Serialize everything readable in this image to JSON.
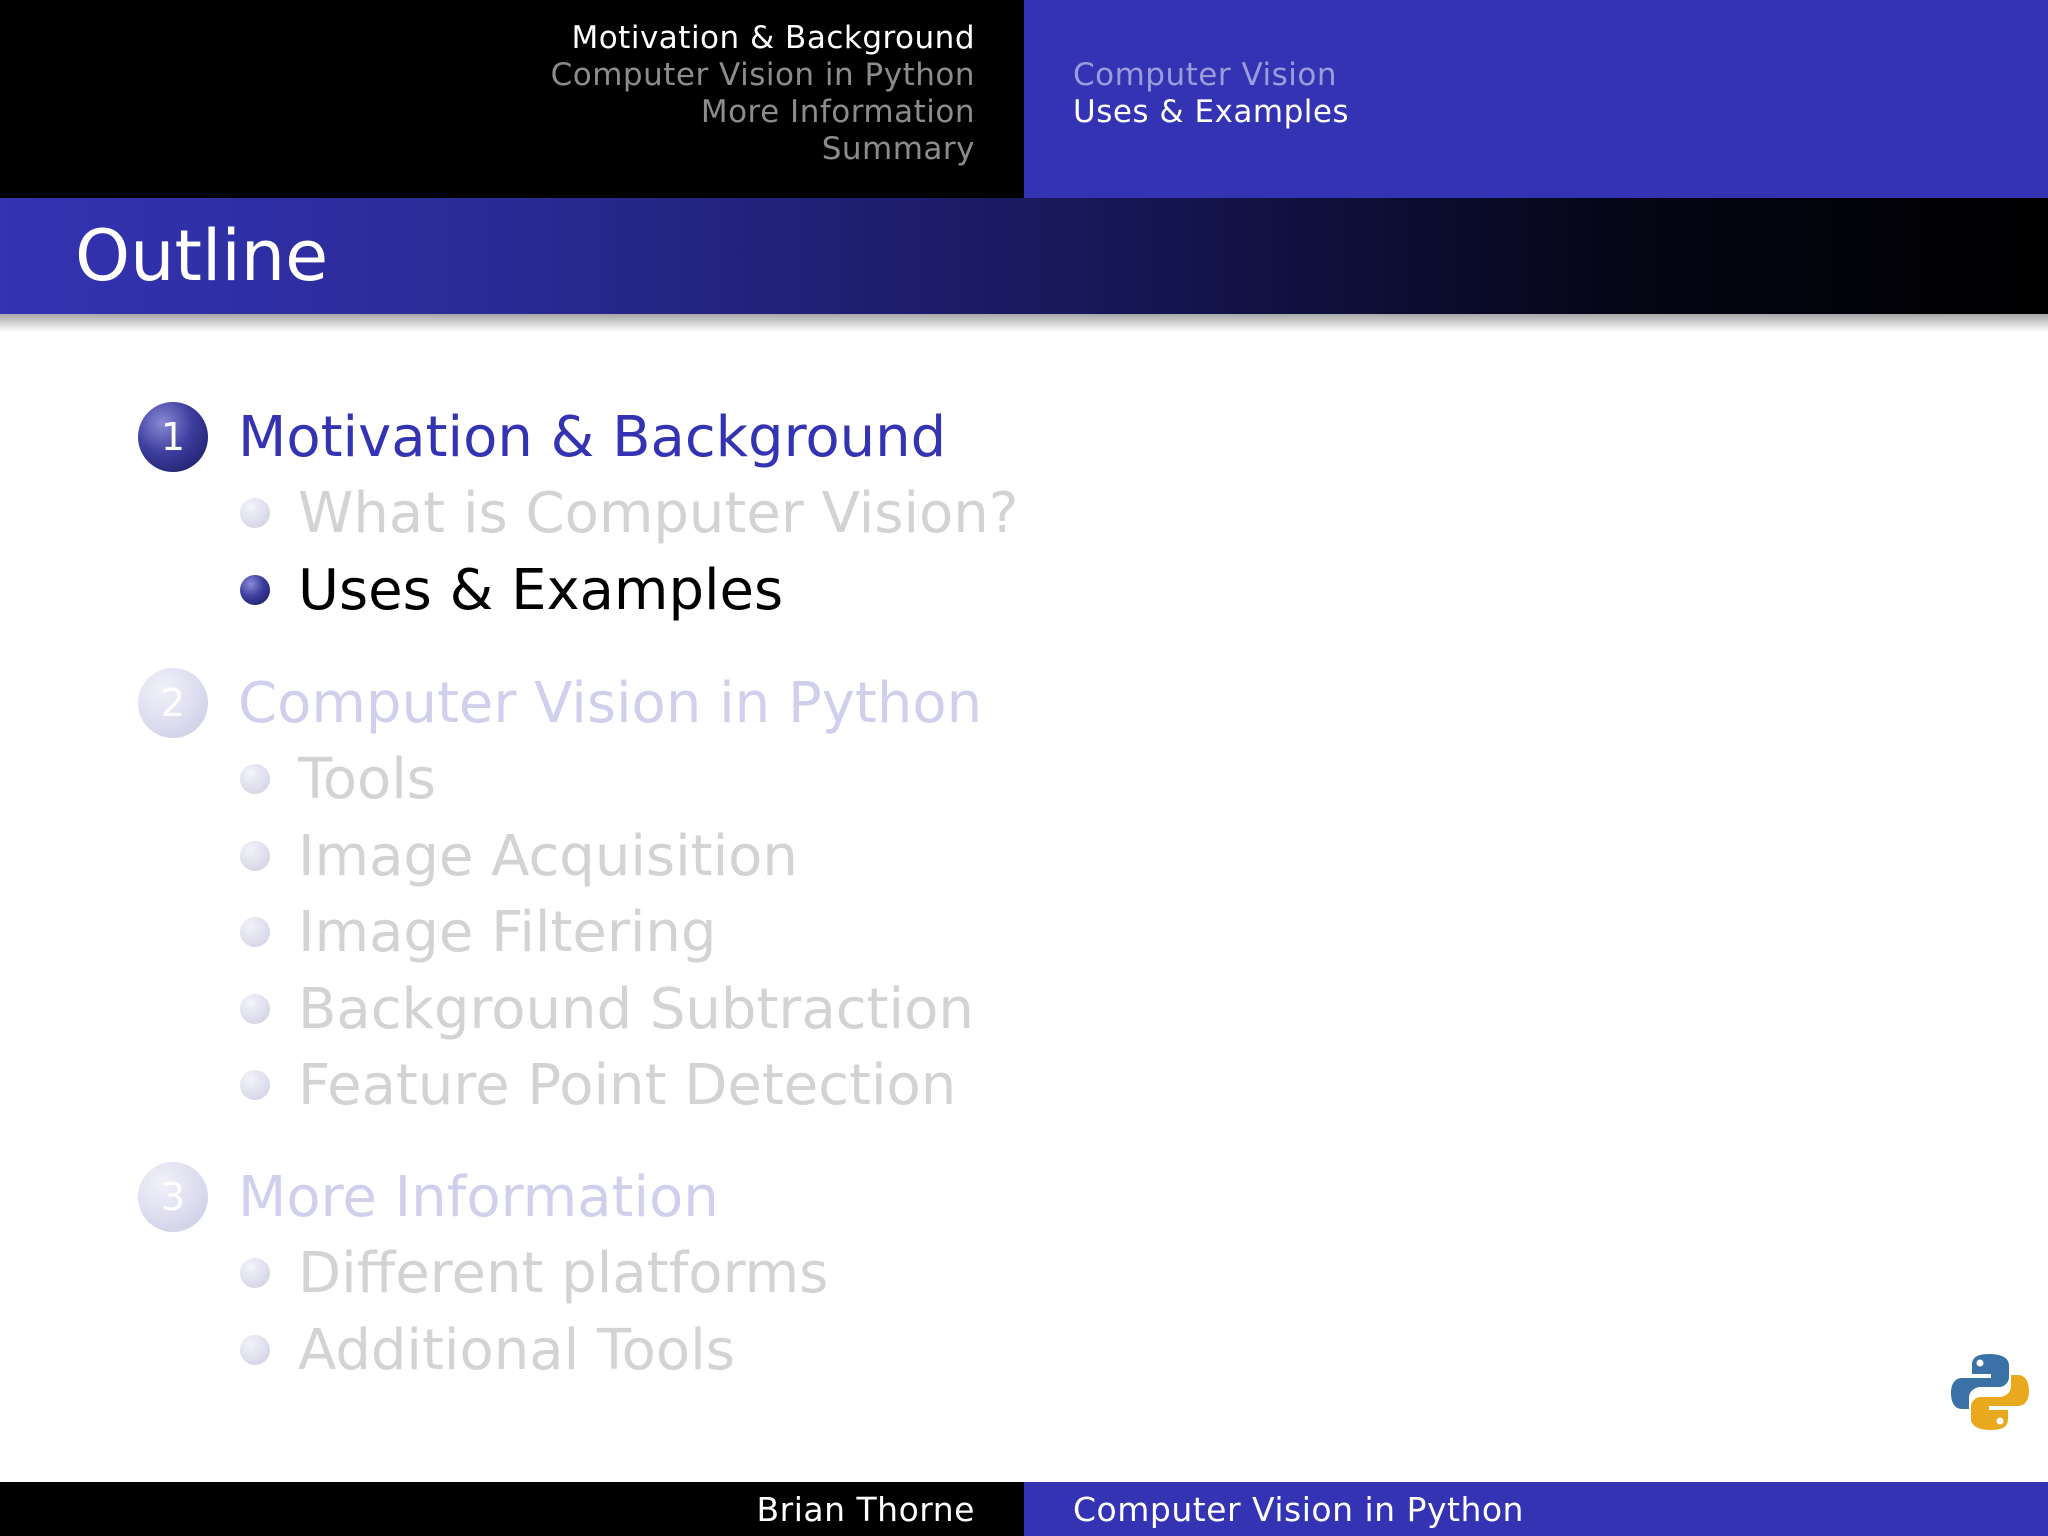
{
  "header": {
    "sections": [
      {
        "label": "Motivation & Background",
        "active": true
      },
      {
        "label": "Computer Vision in Python",
        "active": false
      },
      {
        "label": "More Information",
        "active": false
      },
      {
        "label": "Summary",
        "active": false
      }
    ],
    "subsections": [
      {
        "label": "Computer Vision",
        "active": false
      },
      {
        "label": "Uses & Examples",
        "active": true
      }
    ]
  },
  "frame": {
    "title": "Outline"
  },
  "outline": [
    {
      "number": "1",
      "label": "Motivation & Background",
      "state": "active",
      "items": [
        {
          "label": "What is Computer Vision?",
          "state": "dim"
        },
        {
          "label": "Uses & Examples",
          "state": "active"
        }
      ]
    },
    {
      "number": "2",
      "label": "Computer Vision in Python",
      "state": "dim",
      "items": [
        {
          "label": "Tools",
          "state": "dim"
        },
        {
          "label": "Image Acquisition",
          "state": "dim"
        },
        {
          "label": "Image Filtering",
          "state": "dim"
        },
        {
          "label": "Background Subtraction",
          "state": "dim"
        },
        {
          "label": "Feature Point Detection",
          "state": "dim"
        }
      ]
    },
    {
      "number": "3",
      "label": "More Information",
      "state": "dim",
      "items": [
        {
          "label": "Different platforms",
          "state": "dim"
        },
        {
          "label": "Additional Tools",
          "state": "dim"
        }
      ]
    }
  ],
  "logo": {
    "icon": "python-logo-icon"
  },
  "footer": {
    "author": "Brian Thorne",
    "title": "Computer Vision in Python"
  },
  "colors": {
    "accent": "#3333b3",
    "header_bg": "#000000",
    "dim_text": "#d3d3d3",
    "dim_section": "#d0d0ec"
  }
}
